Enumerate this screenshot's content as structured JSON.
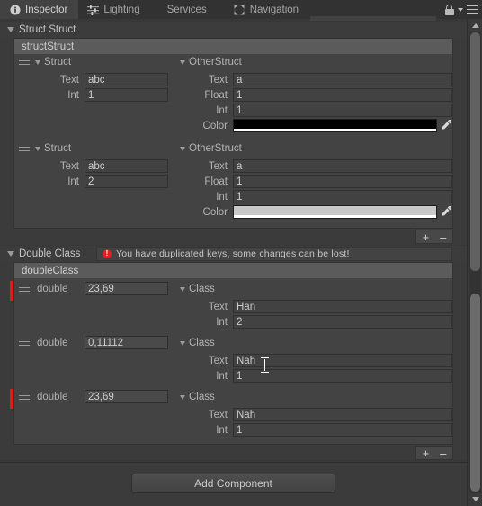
{
  "window": {
    "tabs": [
      {
        "label": "Inspector",
        "icon": "info-icon",
        "active": true
      },
      {
        "label": "Lighting",
        "icon": "lighting-icon",
        "active": false
      },
      {
        "label": "Services",
        "icon": "none",
        "active": false
      },
      {
        "label": "Navigation",
        "icon": "navigation-icon",
        "active": false
      }
    ],
    "lock_icon": "lock-icon",
    "menu_icon": "hamburger-menu-icon"
  },
  "components": [
    {
      "title": "Struct Struct",
      "list_title": "structStruct",
      "add_label": "+",
      "remove_label": "–",
      "elements": [
        {
          "left": {
            "name": "Struct",
            "fields": [
              {
                "label": "Text",
                "value": "abc",
                "type": "text"
              },
              {
                "label": "Int",
                "value": "1",
                "type": "int"
              }
            ]
          },
          "right": {
            "name": "OtherStruct",
            "fields": [
              {
                "label": "Text",
                "value": "a",
                "type": "text"
              },
              {
                "label": "Float",
                "value": "1",
                "type": "float"
              },
              {
                "label": "Int",
                "value": "1",
                "type": "int"
              },
              {
                "label": "Color",
                "value": "#000000",
                "type": "color"
              }
            ]
          }
        },
        {
          "left": {
            "name": "Struct",
            "fields": [
              {
                "label": "Text",
                "value": "abc",
                "type": "text"
              },
              {
                "label": "Int",
                "value": "2",
                "type": "int"
              }
            ]
          },
          "right": {
            "name": "OtherStruct",
            "fields": [
              {
                "label": "Text",
                "value": "a",
                "type": "text"
              },
              {
                "label": "Float",
                "value": "1",
                "type": "float"
              },
              {
                "label": "Int",
                "value": "1",
                "type": "int"
              },
              {
                "label": "Color",
                "value": "#c8c8c8",
                "type": "color"
              }
            ]
          }
        }
      ]
    },
    {
      "title": "Double Class",
      "list_title": "doubleClass",
      "warning": "You have duplicated keys, some changes can be lost!",
      "warning_icon": "error-icon",
      "warning_color": "#e02020",
      "add_label": "+",
      "remove_label": "–",
      "elements": [
        {
          "duplicate": true,
          "key_label": "double",
          "key_value": "23,69",
          "right": {
            "name": "Class",
            "fields": [
              {
                "label": "Text",
                "value": "Han",
                "type": "text"
              },
              {
                "label": "Int",
                "value": "2",
                "type": "int"
              }
            ]
          }
        },
        {
          "duplicate": false,
          "key_label": "double",
          "key_value": "0,11112",
          "right": {
            "name": "Class",
            "fields": [
              {
                "label": "Text",
                "value": "Nah",
                "type": "text"
              },
              {
                "label": "Int",
                "value": "1",
                "type": "int"
              }
            ]
          }
        },
        {
          "duplicate": true,
          "key_label": "double",
          "key_value": "23,69",
          "right": {
            "name": "Class",
            "fields": [
              {
                "label": "Text",
                "value": "Nah",
                "type": "text"
              },
              {
                "label": "Int",
                "value": "1",
                "type": "int"
              }
            ]
          }
        }
      ]
    }
  ],
  "footer": {
    "add_component_label": "Add Component"
  }
}
